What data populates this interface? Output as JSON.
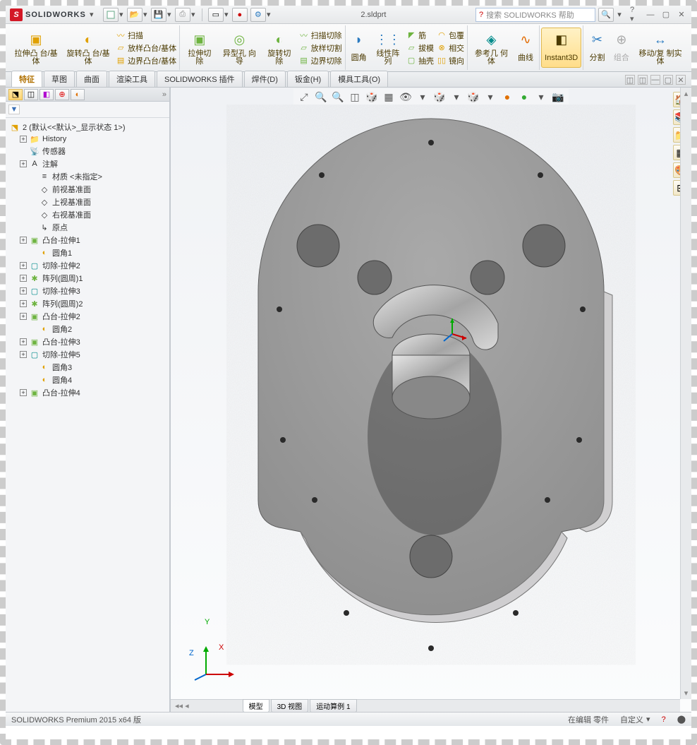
{
  "title": {
    "brand": "SOLIDWORKS",
    "docname": "2.sldprt"
  },
  "search": {
    "placeholder": "搜索 SOLIDWORKS 帮助"
  },
  "qa": {
    "new": "□",
    "open": "▭",
    "save": "▭",
    "print": "▭",
    "undo": "↶",
    "select": "▭",
    "rebuild": "▭",
    "options": "▭"
  },
  "ribbon": {
    "g1": {
      "extrude": "拉伸凸\n台/基体",
      "revolve": "旋转凸\n台/基体",
      "sweep": "扫描",
      "loft": "放样凸台/基体",
      "boundary": "边界凸台/基体"
    },
    "g2": {
      "cutExtrude": "拉伸切\n除",
      "hole": "异型孔\n向导",
      "cutRevolve": "旋转切\n除",
      "cutSweep": "扫描切除",
      "cutLoft": "放样切割",
      "cutBoundary": "边界切除"
    },
    "g3": {
      "fillet": "圆角",
      "linpat": "线性阵\n列",
      "rib": "筋",
      "draft": "拔模",
      "shell": "抽壳",
      "wrap": "包覆",
      "intersect": "相交",
      "mirror": "镜向"
    },
    "g4": {
      "refgeo": "参考几\n何体",
      "curve": "曲线"
    },
    "g5": {
      "instant3d": "Instant3D"
    },
    "g6": {
      "split": "分割",
      "combine": "组合",
      "move": "移动/复\n制实体"
    }
  },
  "tabs": [
    "特征",
    "草图",
    "曲面",
    "渲染工具",
    "SOLIDWORKS 插件",
    "焊件(D)",
    "钣金(H)",
    "模具工具(O)"
  ],
  "tree": {
    "root": "2  (默认<<默认>_显示状态 1>)",
    "items": [
      {
        "icon": "📁",
        "label": "History",
        "tw": "+",
        "ind": 1
      },
      {
        "icon": "📡",
        "label": "传感器",
        "tw": "",
        "ind": 1
      },
      {
        "icon": "A",
        "label": "注解",
        "tw": "+",
        "ind": 1
      },
      {
        "icon": "≡",
        "label": "材质 <未指定>",
        "tw": "",
        "ind": 2
      },
      {
        "icon": "◇",
        "label": "前视基准面",
        "tw": "",
        "ind": 2
      },
      {
        "icon": "◇",
        "label": "上视基准面",
        "tw": "",
        "ind": 2
      },
      {
        "icon": "◇",
        "label": "右视基准面",
        "tw": "",
        "ind": 2
      },
      {
        "icon": "↳",
        "label": "原点",
        "tw": "",
        "ind": 2
      },
      {
        "icon": "▣",
        "label": "凸台-拉伸1",
        "tw": "+",
        "ind": 1,
        "cls": "ic-green"
      },
      {
        "icon": "◐",
        "label": "圆角1",
        "tw": "",
        "ind": 2,
        "cls": "ic-yellow"
      },
      {
        "icon": "▢",
        "label": "切除-拉伸2",
        "tw": "+",
        "ind": 1,
        "cls": "ic-teal"
      },
      {
        "icon": "✱",
        "label": "阵列(圆周)1",
        "tw": "+",
        "ind": 1,
        "cls": "ic-green"
      },
      {
        "icon": "▢",
        "label": "切除-拉伸3",
        "tw": "+",
        "ind": 1,
        "cls": "ic-teal"
      },
      {
        "icon": "✱",
        "label": "阵列(圆周)2",
        "tw": "+",
        "ind": 1,
        "cls": "ic-green"
      },
      {
        "icon": "▣",
        "label": "凸台-拉伸2",
        "tw": "+",
        "ind": 1,
        "cls": "ic-green"
      },
      {
        "icon": "◐",
        "label": "圆角2",
        "tw": "",
        "ind": 2,
        "cls": "ic-yellow"
      },
      {
        "icon": "▣",
        "label": "凸台-拉伸3",
        "tw": "+",
        "ind": 1,
        "cls": "ic-green"
      },
      {
        "icon": "▢",
        "label": "切除-拉伸5",
        "tw": "+",
        "ind": 1,
        "cls": "ic-teal"
      },
      {
        "icon": "◐",
        "label": "圆角3",
        "tw": "",
        "ind": 2,
        "cls": "ic-yellow"
      },
      {
        "icon": "◐",
        "label": "圆角4",
        "tw": "",
        "ind": 2,
        "cls": "ic-yellow"
      },
      {
        "icon": "▣",
        "label": "凸台-拉伸4",
        "tw": "+",
        "ind": 1,
        "cls": "ic-green"
      }
    ]
  },
  "triad": {
    "x": "X",
    "y": "Y",
    "z": "Z"
  },
  "btabs": [
    "模型",
    "3D 视图",
    "运动算例 1"
  ],
  "status": {
    "version": "SOLIDWORKS Premium 2015 x64 版",
    "edit": "在编辑 零件",
    "custom": "自定义"
  }
}
